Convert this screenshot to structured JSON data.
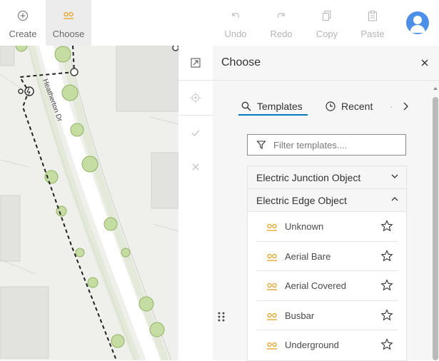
{
  "toolbar": {
    "create": "Create",
    "choose": "Choose",
    "undo": "Undo",
    "redo": "Redo",
    "copy": "Copy",
    "paste": "Paste"
  },
  "map": {
    "street_label": "Heatherton Dr"
  },
  "panel": {
    "title": "Choose",
    "tabs": {
      "templates": "Templates",
      "recent": "Recent"
    },
    "filter_placeholder": "Filter templates....",
    "groups": [
      {
        "title": "Electric Junction Object",
        "expanded": false
      },
      {
        "title": "Electric Edge Object",
        "expanded": true,
        "items": [
          "Unknown",
          "Aerial Bare",
          "Aerial Covered",
          "Busbar",
          "Underground"
        ]
      }
    ]
  },
  "colors": {
    "accent": "#0079c1",
    "symbol": "#e8a020",
    "avatar": "#4b8fe8"
  }
}
